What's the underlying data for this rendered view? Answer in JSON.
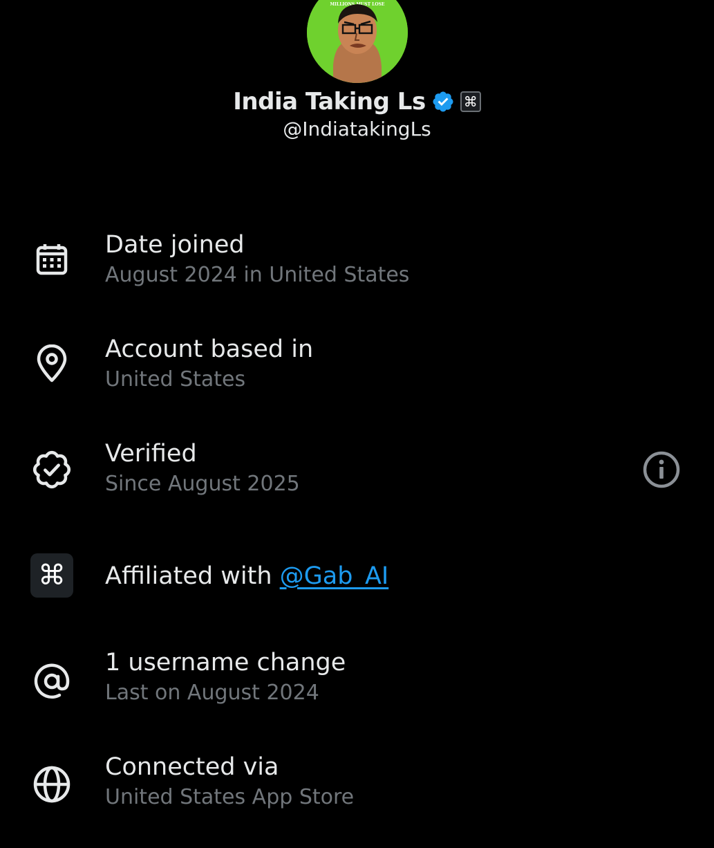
{
  "profile": {
    "display_name": "India Taking Ls",
    "handle": "@IndiatakingLs",
    "avatar_label": "MILLIONS MUST LOSE",
    "verified_badge": "verified-badge-icon",
    "affiliate_badge_glyph": "⌘"
  },
  "rows": [
    {
      "icon": "calendar-icon",
      "title": "Date joined",
      "subtitle": "August 2024 in United States"
    },
    {
      "icon": "location-pin-icon",
      "title": "Account based in",
      "subtitle": "United States"
    },
    {
      "icon": "verified-outline-icon",
      "title": "Verified",
      "subtitle": "Since August 2025",
      "action_icon": "info-icon"
    },
    {
      "icon": "affiliate-logo-icon",
      "title_prefix": "Affiliated with ",
      "link": "@Gab_AI",
      "glyph": "⌘"
    },
    {
      "icon": "at-sign-icon",
      "title": "1 username change",
      "subtitle": "Last on August 2024"
    },
    {
      "icon": "globe-icon",
      "title": "Connected via",
      "subtitle": "United States App Store"
    }
  ],
  "colors": {
    "background": "#000000",
    "primary_text": "#e7e9ea",
    "secondary_text": "#71767b",
    "link": "#1d9bf0",
    "verified": "#1d9bf0",
    "avatar_bg": "#6fd12e"
  }
}
